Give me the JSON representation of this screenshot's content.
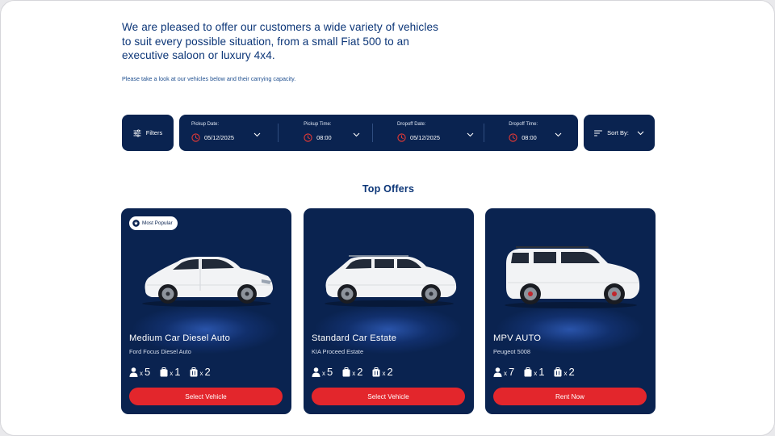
{
  "intro": {
    "heading": "We are pleased to offer our customers a wide variety of vehicles to suit every possible situation, from a small Fiat 500 to an executive saloon or luxury 4x4.",
    "subtext": "Please take a look at our vehicles below and their carrying capacity."
  },
  "search": {
    "filters_label": "Filters",
    "filters_icon": "sliders-icon",
    "pickup_date_label": "Pickup Date:",
    "pickup_date_value": "05/12/2025",
    "pickup_time_label": "Pickup Time:",
    "pickup_time_value": "08:00",
    "dropoff_date_label": "Dropoff Date:",
    "dropoff_date_value": "05/12/2025",
    "dropoff_time_label": "Dropoff Time:",
    "dropoff_time_value": "08:00",
    "sort_label": "Sort By:",
    "sort_icon": "sort-icon"
  },
  "offers": {
    "title": "Top Offers",
    "cards": [
      {
        "badge": "Most Popular",
        "title": "Medium Car Diesel Auto",
        "subtitle": "Ford Focus Diesel Auto",
        "passengers": "5",
        "large_bags": "1",
        "small_bags": "2",
        "x": "x",
        "button": "Select Vehicle"
      },
      {
        "title": "Standard Car Estate",
        "subtitle": "KIA Proceed Estate",
        "passengers": "5",
        "large_bags": "2",
        "small_bags": "2",
        "x": "x",
        "button": "Select Vehicle"
      },
      {
        "title": "MPV AUTO",
        "subtitle": "Peugeot 5008",
        "passengers": "7",
        "large_bags": "1",
        "small_bags": "2",
        "x": "x",
        "button": "Rent Now"
      }
    ]
  },
  "colors": {
    "navy": "#0a2350",
    "accent_red": "#e3262c",
    "heading_blue": "#0b3577",
    "clock_red": "#e53935"
  }
}
